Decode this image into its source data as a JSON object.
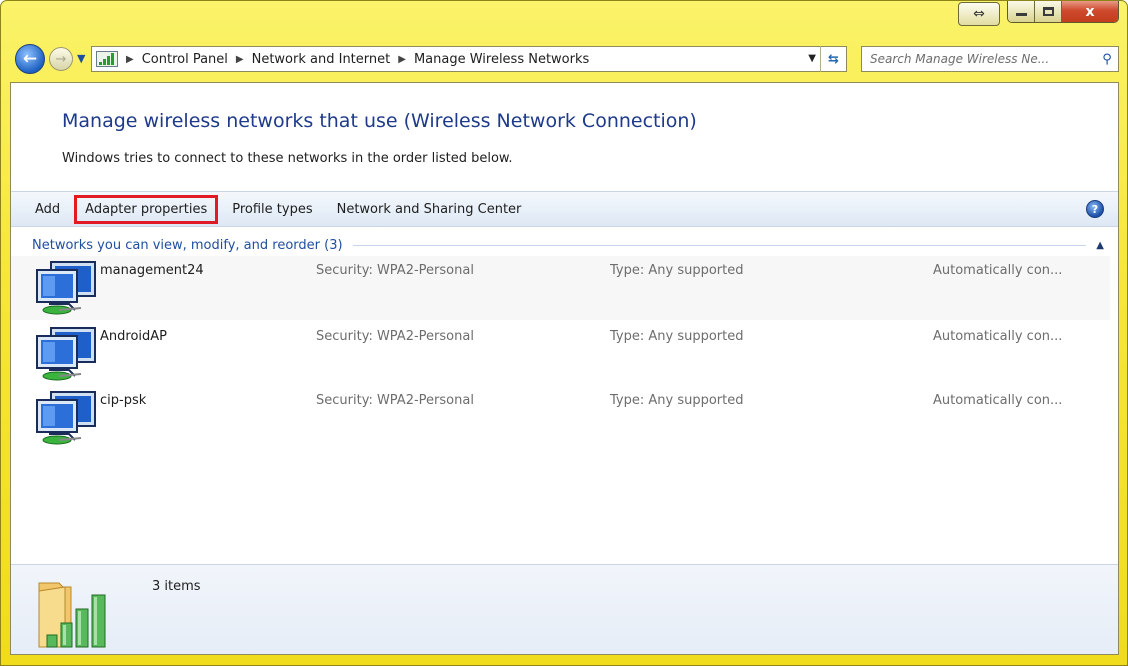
{
  "window": {
    "caption": {
      "swap_label": "⇔",
      "close_label": "x"
    }
  },
  "address_bar": {
    "breadcrumbs": [
      "Control Panel",
      "Network and Internet",
      "Manage Wireless Networks"
    ],
    "icon": "network-bars-icon"
  },
  "search": {
    "placeholder": "Search Manage Wireless Ne..."
  },
  "header": {
    "title": "Manage wireless networks that use (Wireless Network Connection)",
    "subtitle": "Windows tries to connect to these networks in the order listed below."
  },
  "toolbar": {
    "add_label": "Add",
    "adapter_label": "Adapter properties",
    "profile_label": "Profile types",
    "sharing_label": "Network and Sharing Center",
    "help_label": "?"
  },
  "group": {
    "label": "Networks you can view, modify, and reorder (3)"
  },
  "networks": [
    {
      "name": "management24",
      "security": "Security: WPA2-Personal",
      "type": "Type: Any supported",
      "mode": "Automatically con..."
    },
    {
      "name": "AndroidAP",
      "security": "Security: WPA2-Personal",
      "type": "Type: Any supported",
      "mode": "Automatically con..."
    },
    {
      "name": "cip-psk",
      "security": "Security: WPA2-Personal",
      "type": "Type: Any supported",
      "mode": "Automatically con..."
    }
  ],
  "details": {
    "count_text": "3 items"
  },
  "colors": {
    "frame": "#f6e73a",
    "title": "#1e3a8a",
    "highlight": "#e01b24",
    "group": "#1f4fa0"
  }
}
